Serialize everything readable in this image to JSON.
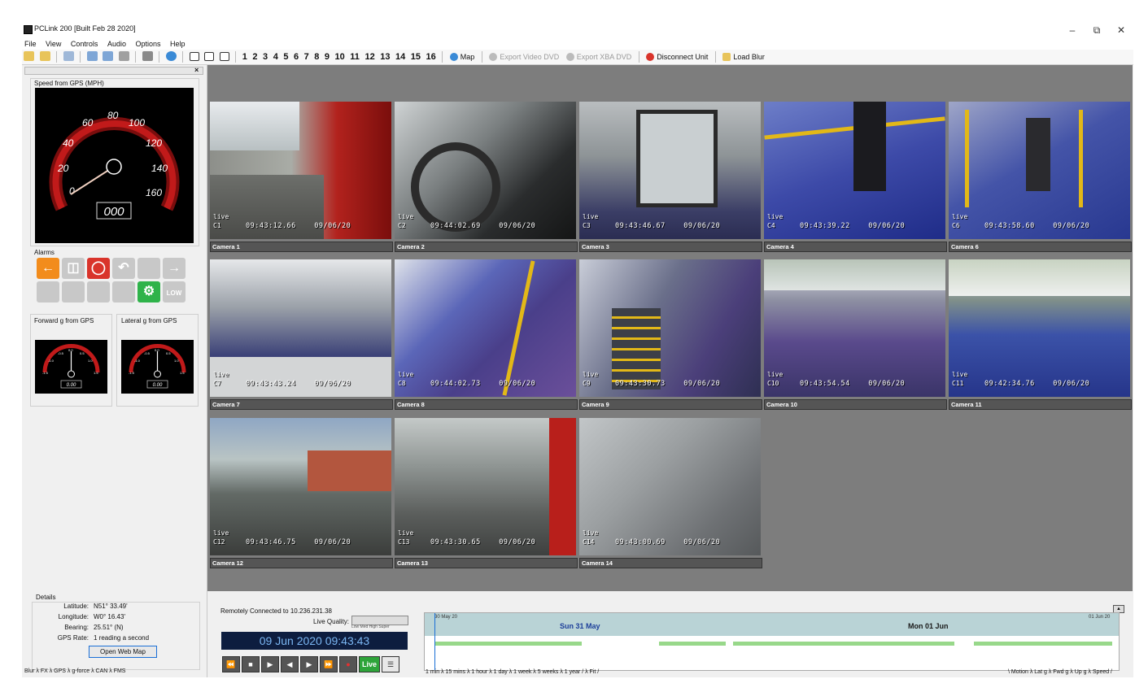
{
  "window": {
    "title": "PCLink 200 [Built Feb 28 2020]",
    "minimize": "–",
    "restore": "⧉",
    "close": "✕"
  },
  "menu": [
    "File",
    "View",
    "Controls",
    "Audio",
    "Options",
    "Help"
  ],
  "toolbar": {
    "layout_numbers": [
      "1",
      "2",
      "3",
      "4",
      "5",
      "6",
      "7",
      "8",
      "9",
      "10",
      "11",
      "12",
      "13",
      "14",
      "15",
      "16"
    ],
    "map": "Map",
    "export_video": "Export Video DVD",
    "export_xba": "Export XBA DVD",
    "disconnect": "Disconnect Unit",
    "load_blur": "Load Blur"
  },
  "left_panel": {
    "close": "×",
    "speed_label": "Speed from GPS (MPH)",
    "speed_ticks": [
      "0",
      "20",
      "40",
      "60",
      "80",
      "100",
      "120",
      "140",
      "160"
    ],
    "speed_value": "000",
    "alarms_label": "Alarms",
    "forward_g_label": "Forward g from GPS",
    "lateral_g_label": "Lateral g from GPS",
    "forward_g_value": "0.00",
    "lateral_g_value": "0.00",
    "g_ticks": [
      "-1.5",
      "-1.0",
      "-0.5",
      "0.0",
      "0.5",
      "1.0",
      "1.5"
    ],
    "details": {
      "title": "Details",
      "rows": [
        {
          "label": "Latitude:",
          "value": "N51° 33.49'"
        },
        {
          "label": "Longitude:",
          "value": "W0° 16.43'"
        },
        {
          "label": "Bearing:",
          "value": "25.51° (N)"
        },
        {
          "label": "GPS Rate:",
          "value": "1 reading a second"
        }
      ],
      "open_web_map": "Open Web Map"
    },
    "tabs": "Blur λ FX λ GPS λ g-force λ CAN λ FMS"
  },
  "cameras": [
    {
      "label": "Camera 1",
      "id": "C1",
      "live": "live",
      "time": "09:43:12.66",
      "date": "09/06/20"
    },
    {
      "label": "Camera 2",
      "id": "C2",
      "live": "live",
      "time": "09:44:02.69",
      "date": "09/06/20"
    },
    {
      "label": "Camera 3",
      "id": "C3",
      "live": "live",
      "time": "09:43:46.67",
      "date": "09/06/20"
    },
    {
      "label": "Camera 4",
      "id": "C4",
      "live": "live",
      "time": "09:43:39.22",
      "date": "09/06/20"
    },
    {
      "label": "Camera 6",
      "id": "C6",
      "live": "live",
      "time": "09:43:58.60",
      "date": "09/06/20"
    },
    {
      "label": "Camera 7",
      "id": "C7",
      "live": "live",
      "time": "09:43:43.24",
      "date": "09/06/20"
    },
    {
      "label": "Camera 8",
      "id": "C8",
      "live": "live",
      "time": "09:44:02.73",
      "date": "09/06/20"
    },
    {
      "label": "Camera 9",
      "id": "C9",
      "live": "live",
      "time": "09:43:30.73",
      "date": "09/06/20"
    },
    {
      "label": "Camera 10",
      "id": "C10",
      "live": "live",
      "time": "09:43:54.54",
      "date": "09/06/20"
    },
    {
      "label": "Camera 11",
      "id": "C11",
      "live": "live",
      "time": "09:42:34.76",
      "date": "09/06/20"
    },
    {
      "label": "Camera 12",
      "id": "C12",
      "live": "live",
      "time": "09:43:46.75",
      "date": "09/06/20"
    },
    {
      "label": "Camera 13",
      "id": "C13",
      "live": "live",
      "time": "09:43:30.65",
      "date": "09/06/20"
    },
    {
      "label": "Camera 14",
      "id": "C14",
      "live": "live",
      "time": "09:43:00.69",
      "date": "09/06/20"
    }
  ],
  "bottom": {
    "connection": "Remotely Connected to 10.236.231.38",
    "live_quality": "Live Quality:",
    "quality_levels": "Low  Med  High  Super",
    "clock": "09 Jun 2020  09:43:43",
    "live_button": "Live",
    "timeline": {
      "start_label": "30 May 20",
      "end_label": "01 Jun 20",
      "day1": "Sun 31 May",
      "day2": "Mon 01 Jun"
    },
    "zoom_tabs": "1 min λ 15 mins λ 1 hour λ 1 day λ 1 week λ 5 weeks λ 1 year / λ Fit /",
    "right_tabs": "\\ Motion λ Lat g λ Fwd g λ Up g λ Speed /"
  }
}
